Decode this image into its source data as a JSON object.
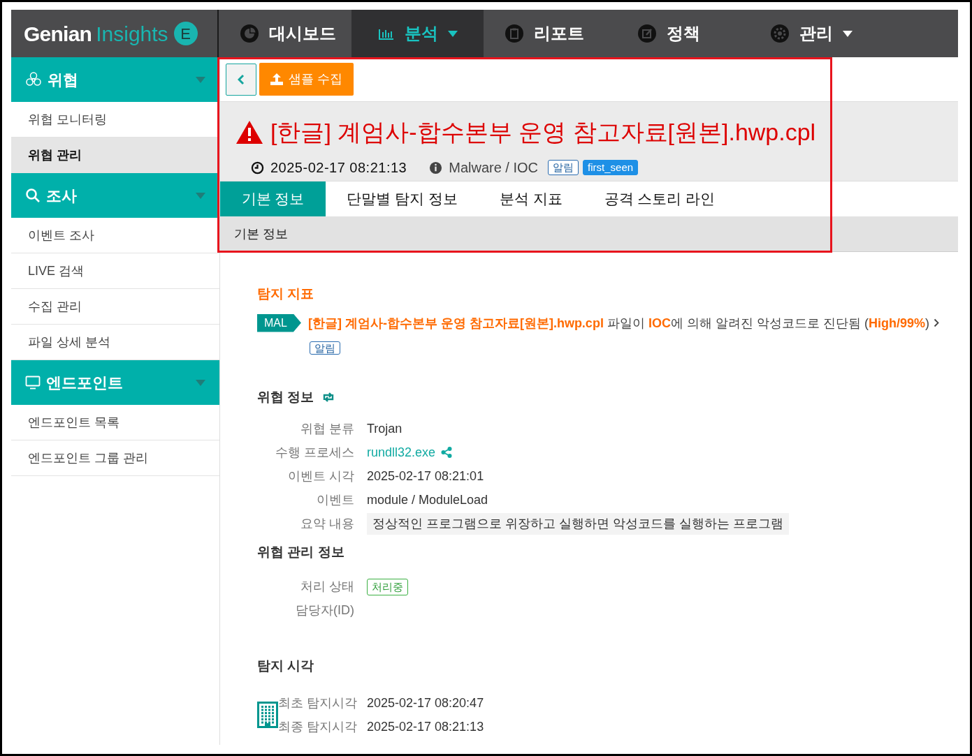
{
  "logo": {
    "word": "Genian",
    "product": "Insights",
    "badge": "E"
  },
  "top_nav": [
    {
      "label": "대시보드",
      "selected": false,
      "has_menu": false
    },
    {
      "label": "분석",
      "selected": true,
      "has_menu": true
    },
    {
      "label": "리포트",
      "selected": false,
      "has_menu": false
    },
    {
      "label": "정책",
      "selected": false,
      "has_menu": false
    },
    {
      "label": "관리",
      "selected": false,
      "has_menu": true
    }
  ],
  "sidebar": [
    {
      "title": "위협",
      "expanded": true,
      "items": [
        {
          "label": "위협 모니터링",
          "selected": false
        },
        {
          "label": "위협 관리",
          "selected": true
        }
      ]
    },
    {
      "title": "조사",
      "expanded": true,
      "items": [
        {
          "label": "이벤트 조사",
          "selected": false
        },
        {
          "label": "LIVE 검색",
          "selected": false
        },
        {
          "label": "수집 관리",
          "selected": false
        },
        {
          "label": "파일 상세 분석",
          "selected": false
        }
      ]
    },
    {
      "title": "엔드포인트",
      "expanded": true,
      "items": [
        {
          "label": "엔드포인트 목록",
          "selected": false
        },
        {
          "label": "엔드포인트 그룹 관리",
          "selected": false
        }
      ]
    }
  ],
  "toolbar": {
    "sample_button": "샘플 수집"
  },
  "header": {
    "title": "[한글] 계엄사-합수본부 운영 참고자료[원본].hwp.cpl",
    "timestamp": "2025-02-17 08:21:13",
    "category": "Malware / IOC",
    "tags": [
      {
        "label": "알림",
        "kind": "outline"
      },
      {
        "label": "first_seen",
        "kind": "filled"
      }
    ]
  },
  "tabs": [
    {
      "label": "기본 정보",
      "selected": true
    },
    {
      "label": "단말별 탐지 정보",
      "selected": false
    },
    {
      "label": "분석 지표",
      "selected": false
    },
    {
      "label": "공격 스토리 라인",
      "selected": false
    }
  ],
  "section_bar": "기본 정보",
  "detection": {
    "heading": "탐지 지표",
    "badge": "MAL",
    "sentence": "**[한글] 계엄사-합수본부 운영 참고자료[원본].hwp.cpl** 파일이 **IOC**에 의해 알려진 악성코드로 진단됨 (**High/99%**)",
    "tag": "알림"
  },
  "threat_info": {
    "heading": "위협 정보",
    "fields": [
      {
        "label": "위협 분류",
        "value": "Trojan",
        "kind": "text"
      },
      {
        "label": "수행 프로세스",
        "value": "rundll32.exe",
        "kind": "link"
      },
      {
        "label": "이벤트 시각",
        "value": "2025-02-17 08:21:01",
        "kind": "text"
      },
      {
        "label": "이벤트",
        "value": "module / ModuleLoad",
        "kind": "text"
      },
      {
        "label": "요약 내용",
        "value": "정상적인 프로그램으로 위장하고 실행하면 악성코드를 실행하는 프로그램",
        "kind": "summary"
      }
    ]
  },
  "management": {
    "heading": "위협 관리 정보",
    "fields": [
      {
        "label": "처리 상태",
        "value": "처리중",
        "kind": "status"
      },
      {
        "label": "담당자(ID)",
        "kind": "text"
      }
    ]
  },
  "detection_time": {
    "heading": "탐지 시각",
    "fields": [
      {
        "label": "최초 탐지시각",
        "value": "2025-02-17 08:20:47"
      },
      {
        "label": "최종 탐지시각",
        "value": "2025-02-17 08:21:13"
      }
    ]
  }
}
